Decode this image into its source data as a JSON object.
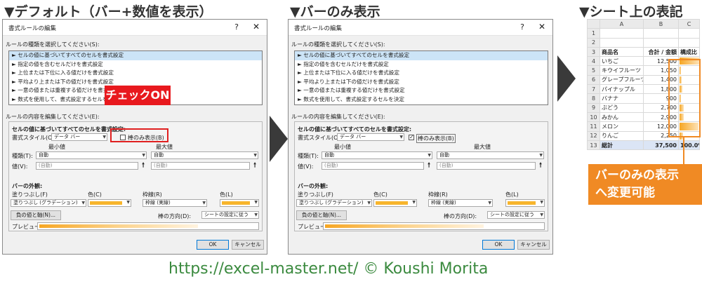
{
  "titles": {
    "left": "▼デフォルト（バー+数値を表示）",
    "middle": "▼バーのみ表示",
    "right": "▼シート上の表記"
  },
  "dialog": {
    "title": "書式ルールの編集",
    "help": "?",
    "close": "✕",
    "select_rule_type_label": "ルールの種類を選択してください(S):",
    "rule_types": [
      "► セルの値に基づいてすべてのセルを書式設定",
      "► 指定の値を含むセルだけを書式設定",
      "► 上位または下位に入る値だけを書式設定",
      "► 平均より上または下の値だけを書式設定",
      "► 一意の値または重複する値だけを書式設定",
      "► 数式を使用して、書式設定するセルを決定"
    ],
    "edit_rule_label": "ルールの内容を編集してください(E):",
    "format_all_label": "セルの値に基づいてすべてのセルを書式設定:",
    "style_label": "書式スタイル(O):",
    "style_value": "データ バー",
    "show_bar_only_label": "棒のみ表示(B)",
    "min_label": "最小値",
    "max_label": "最大値",
    "type_label": "種類(T):",
    "type_min_value": "自動",
    "type_max_value": "自動",
    "value_label": "値(V):",
    "value_min_placeholder": "(自動)",
    "value_max_placeholder": "(自動)",
    "bar_appearance_label": "バーの外観:",
    "fill_label": "塗りつぶし(F)",
    "fill_value": "塗りつぶし (グラデーション)",
    "color_label_1": "色(C)",
    "border_label": "枠線(R)",
    "border_value": "枠線 (実線)",
    "color_label_2": "色(L)",
    "negative_axis_button": "負の値と軸(N)...",
    "bar_direction_label": "棒の方向(D):",
    "bar_direction_value": "シートの設定に従う",
    "preview_label": "プレビュー:",
    "ok_button": "OK",
    "cancel_button": "キャンセル",
    "bar_color": "#f7b52c"
  },
  "left_dialog": {
    "show_bar_only_checked": ""
  },
  "middle_dialog": {
    "show_bar_only_checked": "✓"
  },
  "callout_check_on": "チェックON",
  "sheet": {
    "columns": [
      "",
      "A",
      "B",
      "C"
    ],
    "header_row": {
      "rownum": "3",
      "name": "商品名",
      "amount": "合計 / 金額",
      "ratio": "構成比"
    },
    "empty_rows": [
      "1",
      "2"
    ],
    "rows": [
      {
        "rownum": "4",
        "name": "いちご",
        "amount": "12,500",
        "ratio": 0.333
      },
      {
        "rownum": "5",
        "name": "キウイフルーツ",
        "amount": "1,050",
        "ratio": 0.028
      },
      {
        "rownum": "6",
        "name": "グレープフルーツ",
        "amount": "1,400",
        "ratio": 0.037
      },
      {
        "rownum": "7",
        "name": "パイナップル",
        "amount": "1,800",
        "ratio": 0.048
      },
      {
        "rownum": "8",
        "name": "バナナ",
        "amount": "900",
        "ratio": 0.024
      },
      {
        "rownum": "9",
        "name": "ぶどう",
        "amount": "2,700",
        "ratio": 0.072
      },
      {
        "rownum": "10",
        "name": "みかん",
        "amount": "2,900",
        "ratio": 0.077
      },
      {
        "rownum": "11",
        "name": "メロン",
        "amount": "12,000",
        "ratio": 0.32
      },
      {
        "rownum": "12",
        "name": "りんご",
        "amount": "2,250",
        "ratio": 0.06
      }
    ],
    "total_row": {
      "rownum": "13",
      "name": "総計",
      "amount": "37,500",
      "ratio": "100.0%"
    }
  },
  "orange_callout": {
    "line1": "バーのみの表示",
    "line2": "へ変更可能"
  },
  "footer": "https://excel-master.net/  © Koushi Morita"
}
